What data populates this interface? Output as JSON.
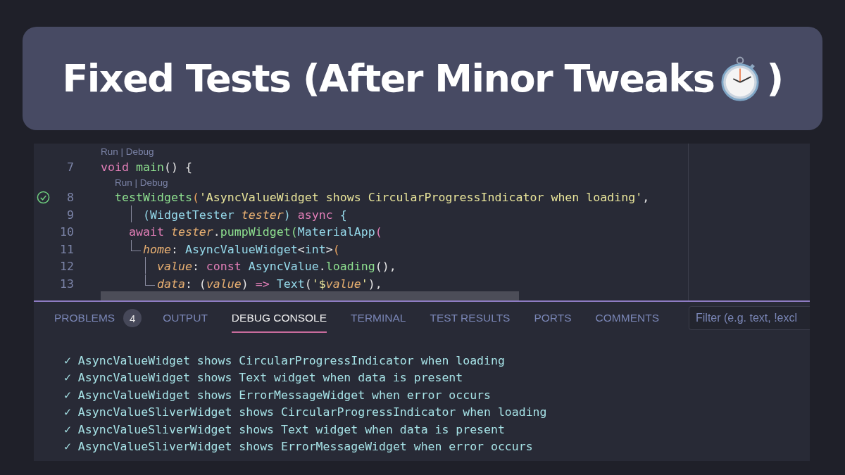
{
  "title": {
    "text": "Fixed Tests (After Minor Tweaks",
    "close": ")"
  },
  "editor": {
    "lines": [
      {
        "number": "7",
        "passed": false,
        "codelens": "Run | Debug",
        "tokens": [
          {
            "kind": "keyword",
            "text": "void"
          },
          {
            "kind": "function",
            "text": " main"
          },
          {
            "kind": "plain",
            "text": "() {"
          }
        ]
      },
      {
        "number": "8",
        "passed": true,
        "codelens": "Run | Debug",
        "tokens": [
          {
            "kind": "function",
            "text": "  testWidgets"
          },
          {
            "kind": "bracket",
            "text": "("
          },
          {
            "kind": "string",
            "text": "'AsyncValueWidget shows CircularProgressIndicator when loading'"
          },
          {
            "kind": "plain",
            "text": ","
          }
        ]
      },
      {
        "number": "9",
        "passed": false,
        "guide": {
          "kind": "bar"
        },
        "tokens": [
          {
            "kind": "type",
            "text": "      (WidgetTester "
          },
          {
            "kind": "param",
            "text": "tester"
          },
          {
            "kind": "type",
            "text": ")"
          },
          {
            "kind": "keyword",
            "text": " async"
          },
          {
            "kind": "type",
            "text": " {"
          }
        ]
      },
      {
        "number": "10",
        "passed": false,
        "tokens": [
          {
            "kind": "keyword",
            "text": "    await"
          },
          {
            "kind": "param",
            "text": " tester"
          },
          {
            "kind": "plain",
            "text": "."
          },
          {
            "kind": "function",
            "text": "pumpWidget"
          },
          {
            "kind": "function",
            "text": "("
          },
          {
            "kind": "type",
            "text": "MaterialApp"
          },
          {
            "kind": "keyword",
            "text": "("
          }
        ]
      },
      {
        "number": "11",
        "passed": false,
        "guide": {
          "kind": "corner"
        },
        "tokens": [
          {
            "kind": "param",
            "text": "      home"
          },
          {
            "kind": "plain",
            "text": ": "
          },
          {
            "kind": "type",
            "text": "AsyncValueWidget"
          },
          {
            "kind": "plain",
            "text": "<"
          },
          {
            "kind": "type",
            "text": "int"
          },
          {
            "kind": "plain",
            "text": ">"
          },
          {
            "kind": "bracket",
            "text": "("
          }
        ]
      },
      {
        "number": "12",
        "passed": false,
        "guide": {
          "kind": "bar"
        },
        "tokens": [
          {
            "kind": "param",
            "text": "        value"
          },
          {
            "kind": "plain",
            "text": ": "
          },
          {
            "kind": "keyword",
            "text": "const"
          },
          {
            "kind": "type",
            "text": " AsyncValue"
          },
          {
            "kind": "plain",
            "text": "."
          },
          {
            "kind": "function",
            "text": "loading"
          },
          {
            "kind": "plain",
            "text": "(),"
          }
        ]
      },
      {
        "number": "13",
        "passed": false,
        "guide": {
          "kind": "corner"
        },
        "tokens": [
          {
            "kind": "param",
            "text": "        data"
          },
          {
            "kind": "plain",
            "text": ": ("
          },
          {
            "kind": "param",
            "text": "value"
          },
          {
            "kind": "plain",
            "text": ") "
          },
          {
            "kind": "keyword",
            "text": "=>"
          },
          {
            "kind": "type",
            "text": " Text"
          },
          {
            "kind": "plain",
            "text": "("
          },
          {
            "kind": "string",
            "text": "'$"
          },
          {
            "kind": "param-string",
            "text": "value"
          },
          {
            "kind": "string",
            "text": "'"
          },
          {
            "kind": "plain",
            "text": "),"
          }
        ]
      }
    ]
  },
  "panel": {
    "tabs": [
      {
        "label": "PROBLEMS",
        "badge": "4",
        "selected": false
      },
      {
        "label": "OUTPUT",
        "selected": false
      },
      {
        "label": "DEBUG CONSOLE",
        "selected": true
      },
      {
        "label": "TERMINAL",
        "selected": false
      },
      {
        "label": "TEST RESULTS",
        "selected": false
      },
      {
        "label": "PORTS",
        "selected": false
      },
      {
        "label": "COMMENTS",
        "selected": false
      }
    ],
    "filter": {
      "placeholder": "Filter (e.g. text, !excl"
    },
    "console": [
      "✓ AsyncValueWidget shows CircularProgressIndicator when loading",
      "✓ AsyncValueWidget shows Text widget when data is present",
      "✓ AsyncValueWidget shows ErrorMessageWidget when error occurs",
      "✓ AsyncValueSliverWidget shows CircularProgressIndicator when loading",
      "✓ AsyncValueSliverWidget shows Text widget when data is present",
      "✓ AsyncValueSliverWidget shows ErrorMessageWidget when error occurs"
    ]
  }
}
